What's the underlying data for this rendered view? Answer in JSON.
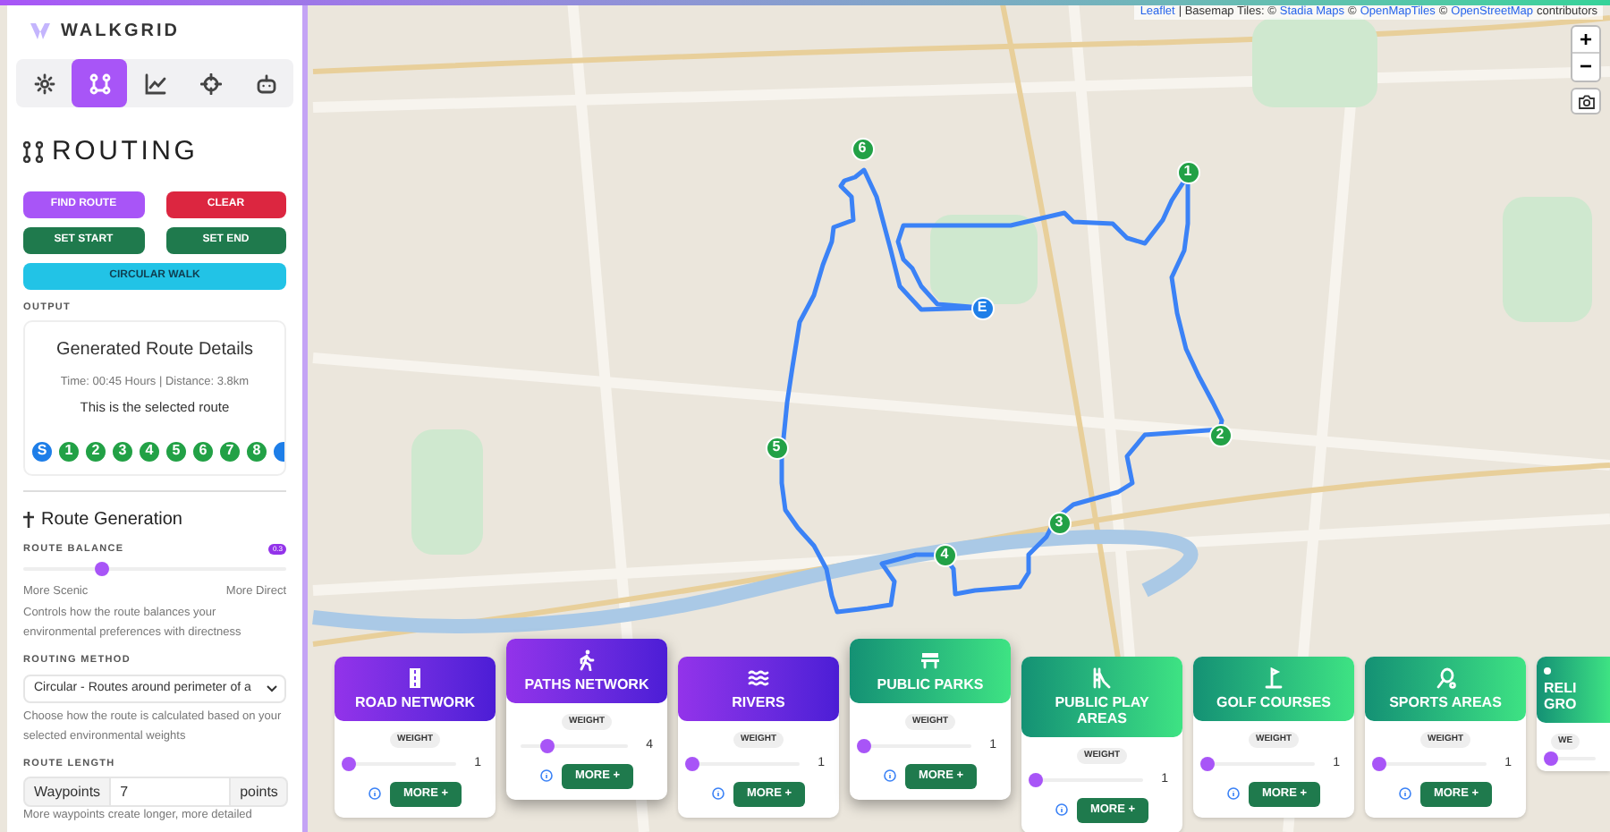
{
  "app": {
    "name": "WALKGRID"
  },
  "tabs": [
    {
      "selected": false
    },
    {
      "selected": true
    },
    {
      "selected": false
    },
    {
      "selected": false
    },
    {
      "selected": false
    }
  ],
  "panel": {
    "title": "ROUTING",
    "buttons": [
      {
        "label": "FIND ROUTE",
        "kind": "purple"
      },
      {
        "label": "CLEAR",
        "kind": "red"
      },
      {
        "label": "SET START",
        "kind": "green"
      },
      {
        "label": "SET END",
        "kind": "green"
      },
      {
        "label": "CIRCULAR WALK",
        "kind": "cyan"
      }
    ],
    "output_label": "OUTPUT",
    "output": {
      "title": "Generated Route Details",
      "meta": "Time: 00:45 Hours | Distance: 3.8km",
      "note": "This is the selected route",
      "waypoints": [
        {
          "label": "S",
          "kind": "start"
        },
        {
          "label": "1",
          "kind": "stop"
        },
        {
          "label": "2",
          "kind": "stop"
        },
        {
          "label": "3",
          "kind": "stop"
        },
        {
          "label": "4",
          "kind": "stop"
        },
        {
          "label": "5",
          "kind": "stop"
        },
        {
          "label": "6",
          "kind": "stop"
        },
        {
          "label": "7",
          "kind": "stop"
        },
        {
          "label": "8",
          "kind": "stop"
        },
        {
          "kind": "end"
        }
      ]
    },
    "section_title": "Route Generation",
    "balance": {
      "label": "ROUTE BALANCE",
      "badge": "0.3",
      "level": 0.3,
      "left": "More Scenic",
      "right": "More Direct",
      "help": "Controls how the route balances your environmental preferences with directness"
    },
    "method": {
      "label": "ROUTING METHOD",
      "value": "Circular - Routes around perimeter of a",
      "help": "Choose how the route is calculated based on your selected environmental weights"
    },
    "length": {
      "label": "ROUTE LENGTH",
      "prefix": "Waypoints",
      "value": "7",
      "suffix": "points",
      "help": "More waypoints create longer, more detailed"
    }
  },
  "map": {
    "attribution": [
      {
        "text": "Leaflet",
        "link": true
      },
      {
        "text": "| Basemap Tiles: ©",
        "link": false
      },
      {
        "text": "Stadia Maps",
        "link": true
      },
      {
        "text": "©",
        "link": false
      },
      {
        "text": "OpenMapTiles",
        "link": true
      },
      {
        "text": "©",
        "link": false
      },
      {
        "text": "OpenStreetMap",
        "link": true
      },
      {
        "text": "contributors",
        "link": false
      }
    ],
    "zoom_in": "+",
    "zoom_out": "−",
    "markers": [
      {
        "label": "6",
        "kind": "stop"
      },
      {
        "label": "1",
        "kind": "stop"
      },
      {
        "label": "E",
        "kind": "end"
      },
      {
        "label": "2",
        "kind": "stop"
      },
      {
        "label": "5",
        "kind": "stop"
      },
      {
        "label": "3",
        "kind": "stop"
      },
      {
        "label": "4",
        "kind": "stop"
      }
    ]
  },
  "layers": [
    {
      "title": "ROAD NETWORK",
      "kind": "purple",
      "active": false,
      "weight_label": "WEIGHT",
      "level": 0,
      "value": "1",
      "more": "MORE +"
    },
    {
      "title": "PATHS NETWORK",
      "kind": "purple",
      "active": true,
      "weight_label": "WEIGHT",
      "level": 0.25,
      "value": "4",
      "more": "MORE +"
    },
    {
      "title": "RIVERS",
      "kind": "purple",
      "active": false,
      "weight_label": "WEIGHT",
      "level": 0,
      "value": "1",
      "more": "MORE +"
    },
    {
      "title": "PUBLIC PARKS",
      "kind": "green",
      "active": true,
      "weight_label": "WEIGHT",
      "level": 0,
      "value": "1",
      "more": "MORE +"
    },
    {
      "title": "PUBLIC PLAY AREAS",
      "kind": "green",
      "active": false,
      "weight_label": "WEIGHT",
      "level": 0,
      "value": "1",
      "more": "MORE +"
    },
    {
      "title": "GOLF COURSES",
      "kind": "green",
      "active": false,
      "weight_label": "WEIGHT",
      "level": 0,
      "value": "1",
      "more": "MORE +"
    },
    {
      "title": "SPORTS AREAS",
      "kind": "green",
      "active": false,
      "weight_label": "WEIGHT",
      "level": 0,
      "value": "1",
      "more": "MORE +"
    },
    {
      "title": "RELI GRO",
      "kind": "green",
      "active": false,
      "weight_label": "WE",
      "level": 0
    }
  ]
}
